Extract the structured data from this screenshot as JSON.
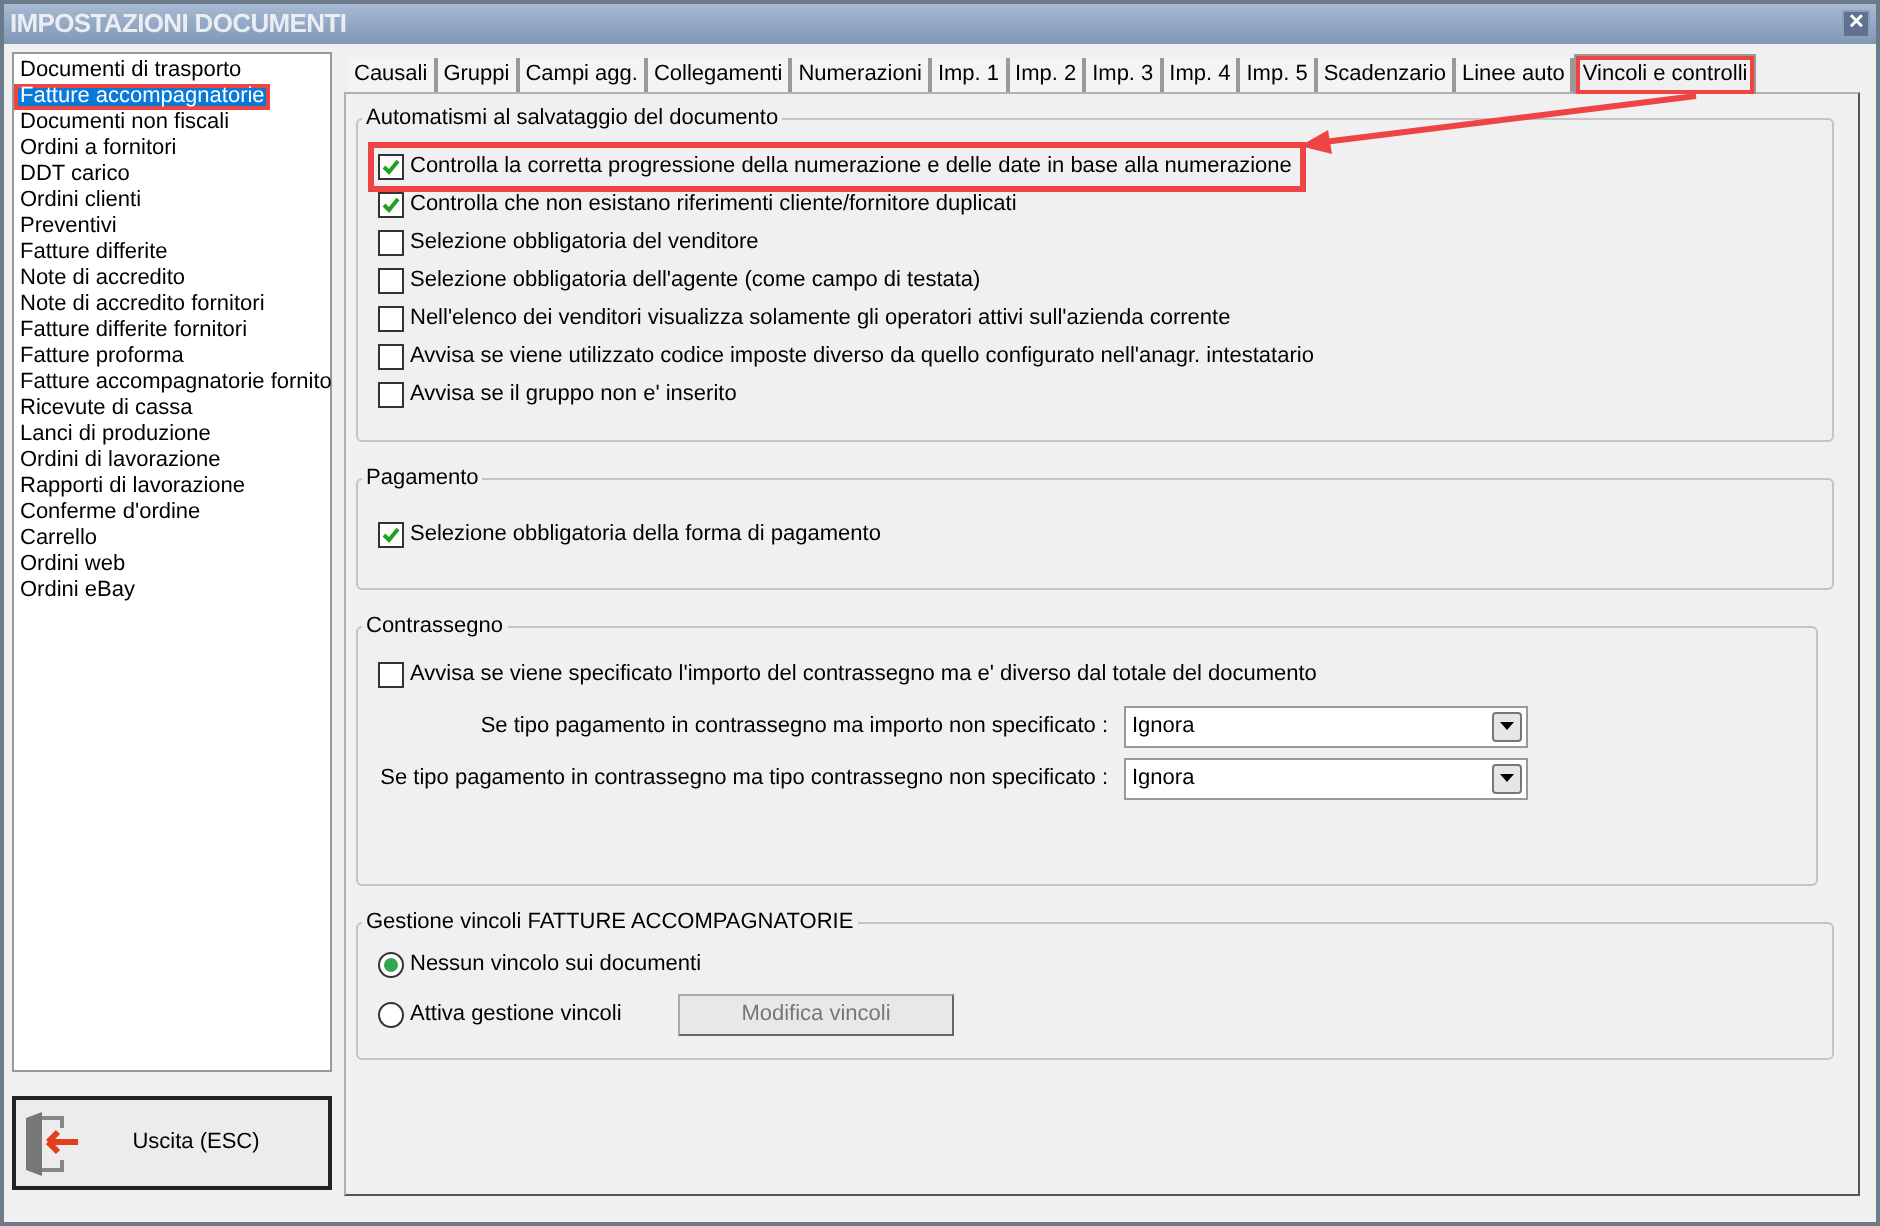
{
  "window": {
    "title": "IMPOSTAZIONI DOCUMENTI",
    "close": "✕"
  },
  "sidebar": {
    "items": [
      {
        "label": "Documenti di trasporto",
        "selected": false,
        "highlighted": false
      },
      {
        "label": "Fatture accompagnatorie",
        "selected": true,
        "highlighted": true
      },
      {
        "label": "Documenti non fiscali",
        "selected": false,
        "highlighted": false
      },
      {
        "label": "Ordini a fornitori",
        "selected": false,
        "highlighted": false
      },
      {
        "label": "DDT carico",
        "selected": false,
        "highlighted": false
      },
      {
        "label": "Ordini clienti",
        "selected": false,
        "highlighted": false
      },
      {
        "label": "Preventivi",
        "selected": false,
        "highlighted": false
      },
      {
        "label": "Fatture differite",
        "selected": false,
        "highlighted": false
      },
      {
        "label": "Note di accredito",
        "selected": false,
        "highlighted": false
      },
      {
        "label": "Note di accredito fornitori",
        "selected": false,
        "highlighted": false
      },
      {
        "label": "Fatture differite fornitori",
        "selected": false,
        "highlighted": false
      },
      {
        "label": "Fatture proforma",
        "selected": false,
        "highlighted": false
      },
      {
        "label": "Fatture accompagnatorie fornito",
        "selected": false,
        "highlighted": false
      },
      {
        "label": "Ricevute di cassa",
        "selected": false,
        "highlighted": false
      },
      {
        "label": "Lanci di produzione",
        "selected": false,
        "highlighted": false
      },
      {
        "label": "Ordini di lavorazione",
        "selected": false,
        "highlighted": false
      },
      {
        "label": "Rapporti di lavorazione",
        "selected": false,
        "highlighted": false
      },
      {
        "label": "Conferme d'ordine",
        "selected": false,
        "highlighted": false
      },
      {
        "label": "Carrello",
        "selected": false,
        "highlighted": false
      },
      {
        "label": "Ordini web",
        "selected": false,
        "highlighted": false
      },
      {
        "label": "Ordini eBay",
        "selected": false,
        "highlighted": false
      }
    ]
  },
  "exit_button": {
    "label": "Uscita (ESC)"
  },
  "tabs": [
    {
      "label": "Causali",
      "selected": false,
      "highlighted": false
    },
    {
      "label": "Gruppi",
      "selected": false,
      "highlighted": false
    },
    {
      "label": "Campi agg.",
      "selected": false,
      "highlighted": false
    },
    {
      "label": "Collegamenti",
      "selected": false,
      "highlighted": false
    },
    {
      "label": "Numerazioni",
      "selected": false,
      "highlighted": false
    },
    {
      "label": "Imp. 1",
      "selected": false,
      "highlighted": false
    },
    {
      "label": "Imp. 2",
      "selected": false,
      "highlighted": false
    },
    {
      "label": "Imp. 3",
      "selected": false,
      "highlighted": false
    },
    {
      "label": "Imp. 4",
      "selected": false,
      "highlighted": false
    },
    {
      "label": "Imp. 5",
      "selected": false,
      "highlighted": false
    },
    {
      "label": "Scadenzario",
      "selected": false,
      "highlighted": false
    },
    {
      "label": "Linee auto",
      "selected": false,
      "highlighted": false
    },
    {
      "label": "Vincoli e controlli",
      "selected": true,
      "highlighted": true
    }
  ],
  "automatismi": {
    "title": "Automatismi al salvataggio del documento",
    "options": [
      {
        "label": "Controlla la corretta progressione della numerazione e delle date in base alla numerazione",
        "checked": true,
        "highlighted": true
      },
      {
        "label": "Controlla che non esistano riferimenti cliente/fornitore duplicati",
        "checked": true
      },
      {
        "label": "Selezione obbligatoria del venditore",
        "checked": false
      },
      {
        "label": "Selezione obbligatoria dell'agente (come campo di testata)",
        "checked": false
      },
      {
        "label": "Nell'elenco dei venditori visualizza solamente gli operatori attivi sull'azienda corrente",
        "checked": false
      },
      {
        "label": "Avvisa se viene utilizzato codice imposte diverso da quello configurato nell'anagr. intestatario",
        "checked": false
      },
      {
        "label": "Avvisa se il gruppo non e' inserito",
        "checked": false
      }
    ]
  },
  "pagamento": {
    "title": "Pagamento",
    "options": [
      {
        "label": "Selezione obbligatoria della forma di pagamento",
        "checked": true
      }
    ]
  },
  "contrassegno": {
    "title": "Contrassegno",
    "options": [
      {
        "label": "Avvisa se viene specificato l'importo del contrassegno ma e' diverso dal totale del documento",
        "checked": false
      }
    ],
    "selects": [
      {
        "label": "Se tipo pagamento in contrassegno ma importo non specificato :",
        "value": "Ignora"
      },
      {
        "label": "Se tipo pagamento in contrassegno ma tipo contrassegno non specificato :",
        "value": "Ignora"
      }
    ]
  },
  "gestione_vincoli": {
    "title": "Gestione vincoli FATTURE ACCOMPAGNATORIE",
    "radios": [
      {
        "label": "Nessun vincolo sui documenti",
        "selected": true
      },
      {
        "label": "Attiva gestione vincoli",
        "selected": false
      }
    ],
    "button": {
      "label": "Modifica vincoli",
      "disabled": true
    }
  }
}
